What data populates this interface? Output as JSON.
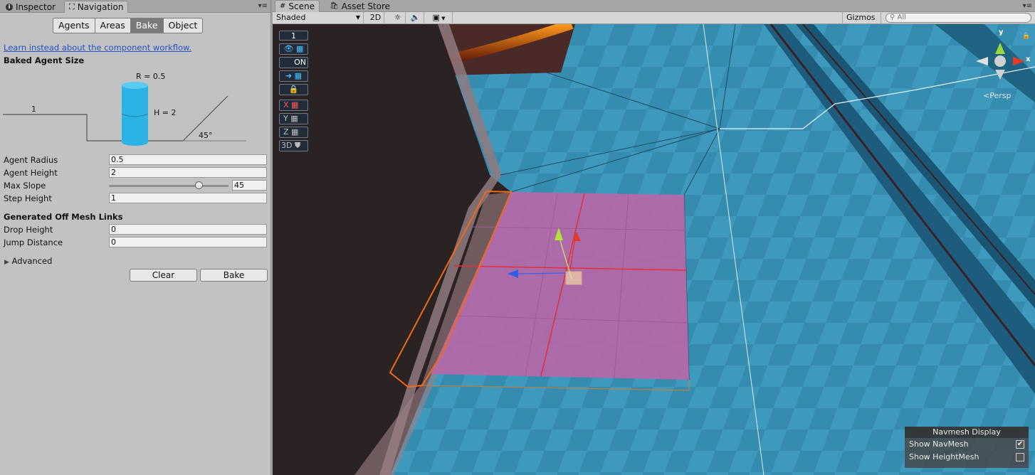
{
  "left_panel": {
    "tabs": {
      "inspector": "Inspector",
      "navigation": "Navigation"
    },
    "segments": [
      "Agents",
      "Areas",
      "Bake",
      "Object"
    ],
    "selected_segment": "Bake",
    "component_link": "Learn instead about the component workflow.",
    "baked_agent_size": {
      "heading": "Baked Agent Size",
      "radius_label": "R = 0.5",
      "height_label": "H = 2",
      "step_label": "1",
      "slope_label": "45°"
    },
    "fields": {
      "agent_radius": {
        "label": "Agent Radius",
        "value": "0.5"
      },
      "agent_height": {
        "label": "Agent Height",
        "value": "2"
      },
      "max_slope": {
        "label": "Max Slope",
        "value": "45",
        "slider_fraction": 0.75
      },
      "step_height": {
        "label": "Step Height",
        "value": "1"
      }
    },
    "off_mesh": {
      "heading": "Generated Off Mesh Links",
      "drop_height": {
        "label": "Drop Height",
        "value": "0"
      },
      "jump_distance": {
        "label": "Jump Distance",
        "value": "0"
      }
    },
    "advanced_label": "Advanced",
    "buttons": {
      "clear": "Clear",
      "bake": "Bake"
    }
  },
  "scene": {
    "tabs": {
      "scene": "Scene",
      "asset_store": "Asset Store"
    },
    "toolbar": {
      "shading": "Shaded",
      "mode_2d": "2D",
      "gizmos": "Gizmos",
      "search_placeholder": "All"
    },
    "overlay_buttons": {
      "count": "1",
      "on": "ON",
      "x": "X",
      "y": "Y",
      "z": "Z",
      "three_d": "3D"
    },
    "gizmo": {
      "y": "y",
      "x": "x",
      "persp": "Persp"
    },
    "navmesh_display": {
      "title": "Navmesh Display",
      "show_navmesh": {
        "label": "Show NavMesh",
        "checked": true
      },
      "show_heightmesh": {
        "label": "Show HeightMesh",
        "checked": false
      }
    },
    "colors": {
      "floor": "#3c95b9",
      "navmesh_selection": "#b667a8",
      "wall": "#2b2224"
    }
  }
}
